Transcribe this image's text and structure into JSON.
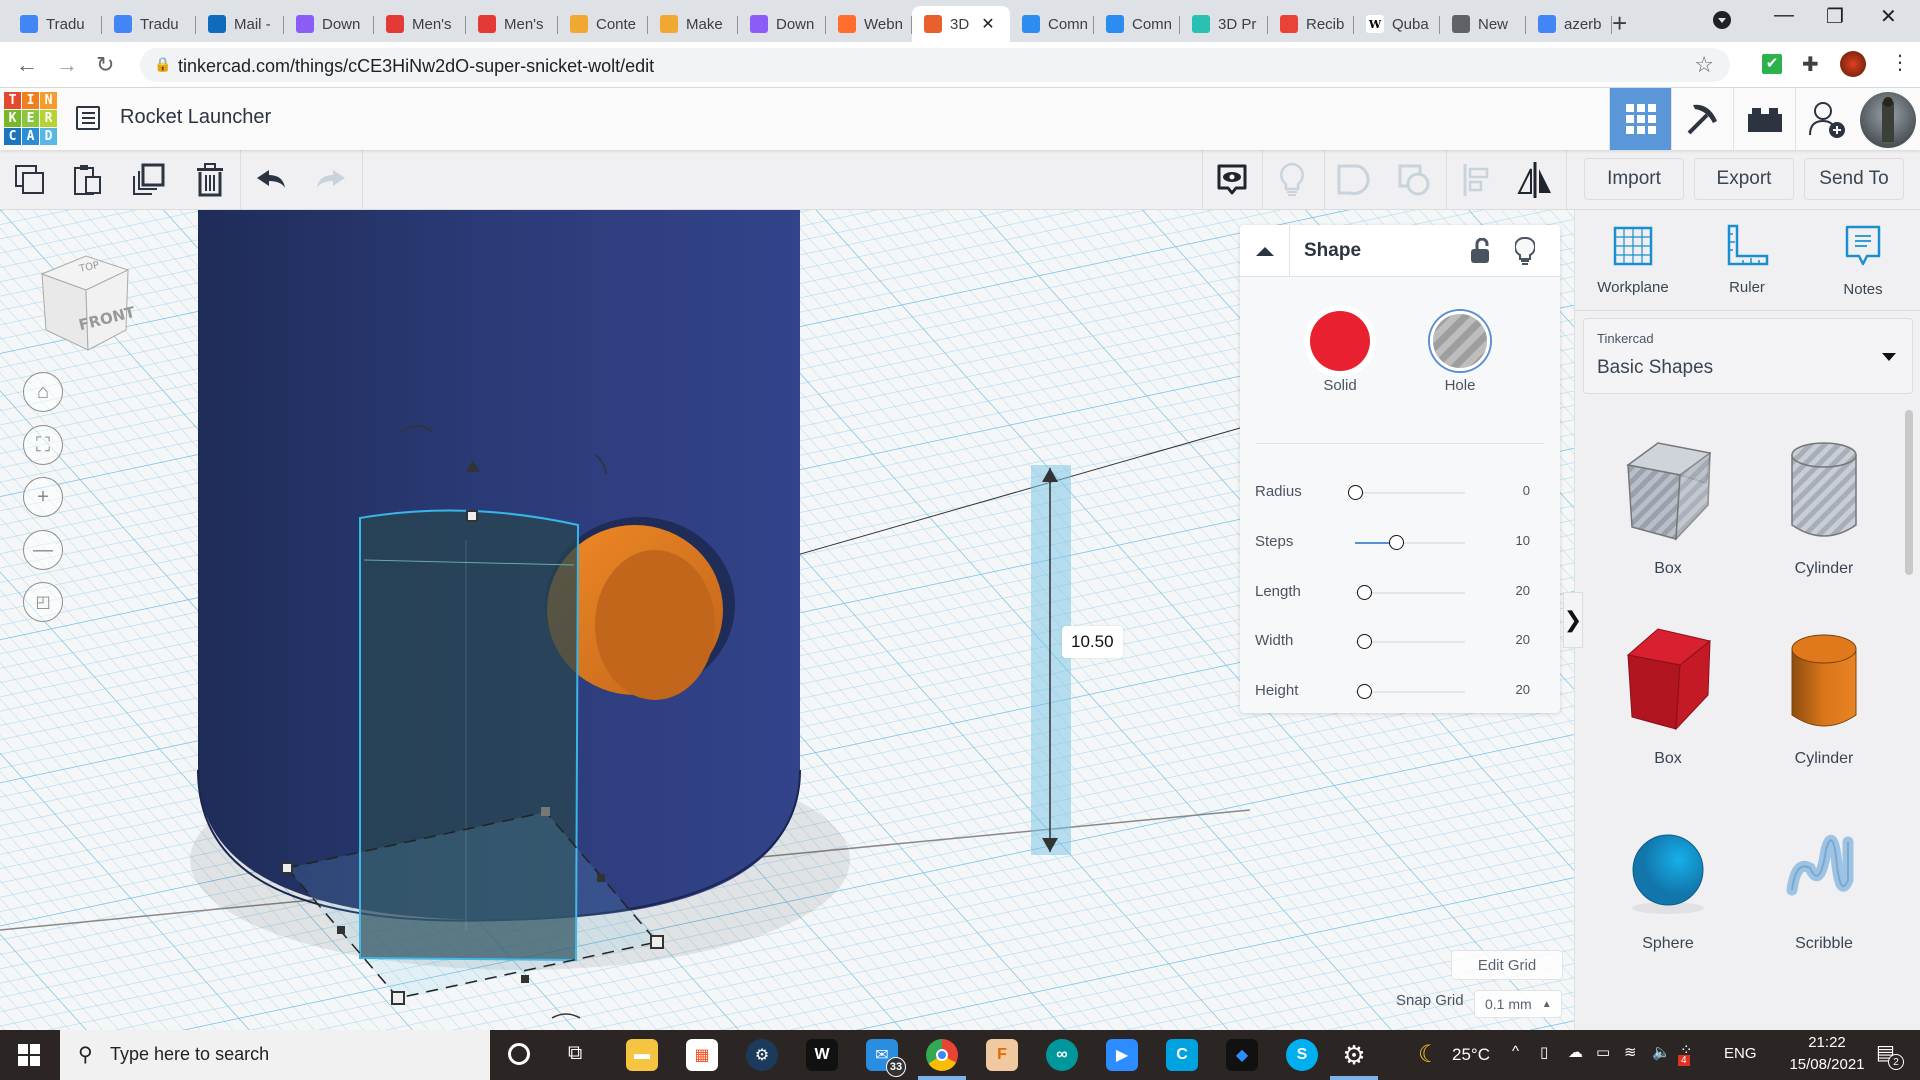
{
  "browser": {
    "tabs": [
      {
        "label": "Tradu",
        "icon": "google-translate-icon",
        "color": "#4285f4"
      },
      {
        "label": "Tradu",
        "icon": "google-translate-icon",
        "color": "#4285f4"
      },
      {
        "label": "Mail -",
        "icon": "outlook-icon",
        "color": "#0f6cbd"
      },
      {
        "label": "Down",
        "icon": "swirl-icon",
        "color": "#8b5cf6"
      },
      {
        "label": "Men's",
        "icon": "shopping-bag-icon",
        "color": "#e53935"
      },
      {
        "label": "Men's",
        "icon": "shopping-bag-icon",
        "color": "#e53935"
      },
      {
        "label": "Conte",
        "icon": "robot-icon",
        "color": "#f0a830"
      },
      {
        "label": "Make",
        "icon": "robot-icon",
        "color": "#f0a830"
      },
      {
        "label": "Down",
        "icon": "swirl-icon",
        "color": "#8b5cf6"
      },
      {
        "label": "Webn",
        "icon": "cpanel-icon",
        "color": "#ff6c2c"
      },
      {
        "label": "3D",
        "icon": "tinkercad-icon",
        "color": "#e8602c",
        "active": true
      },
      {
        "label": "Comn",
        "icon": "t-circle-icon",
        "color": "#2d8cf0"
      },
      {
        "label": "Comn",
        "icon": "t-circle-icon",
        "color": "#2d8cf0"
      },
      {
        "label": "3D Pr",
        "icon": "h-square-icon",
        "color": "#28c0b0"
      },
      {
        "label": "Recib",
        "icon": "gmail-icon",
        "color": "#ea4335"
      },
      {
        "label": "Quba",
        "icon": "wikipedia-icon",
        "color": "#ffffff"
      },
      {
        "label": "New",
        "icon": "chrome-icon",
        "color": "#5f6368"
      },
      {
        "label": "azerb",
        "icon": "google-icon",
        "color": "#4285f4"
      }
    ],
    "url": "tinkercad.com/things/cCE3HiNw2dO-super-snicket-wolt/edit"
  },
  "app": {
    "logo_letters": [
      "T",
      "I",
      "N",
      "K",
      "E",
      "R",
      "C",
      "A",
      "D"
    ],
    "logo_colors": [
      "#e2492f",
      "#f07d1e",
      "#f59c2a",
      "#76b82a",
      "#8cc63f",
      "#b5d334",
      "#1b75bc",
      "#2b8ed4",
      "#58b7e5"
    ],
    "project_title": "Rocket Launcher"
  },
  "toolbar": {
    "import_label": "Import",
    "export_label": "Export",
    "send_to_label": "Send To"
  },
  "viewport": {
    "viewcube_top": "TOP",
    "viewcube_front": "FRONT",
    "dimension_value": "10.50"
  },
  "inspector": {
    "title": "Shape",
    "solid_label": "Solid",
    "hole_label": "Hole",
    "solid_color": "#e8202f",
    "selected_mode": "Hole",
    "params": [
      {
        "label": "Radius",
        "value": "0",
        "fraction": 0.0
      },
      {
        "label": "Steps",
        "value": "10",
        "fraction": 0.37
      },
      {
        "label": "Length",
        "value": "20",
        "fraction": 0.08
      },
      {
        "label": "Width",
        "value": "20",
        "fraction": 0.08
      },
      {
        "label": "Height",
        "value": "20",
        "fraction": 0.08
      }
    ]
  },
  "right_panel": {
    "tools": [
      {
        "label": "Workplane",
        "icon": "workplane-icon"
      },
      {
        "label": "Ruler",
        "icon": "ruler-icon"
      },
      {
        "label": "Notes",
        "icon": "notes-icon"
      }
    ],
    "library_category": "Tinkercad",
    "library_name": "Basic Shapes",
    "shapes": [
      {
        "label": "Box",
        "kind": "hole-box"
      },
      {
        "label": "Cylinder",
        "kind": "hole-cylinder"
      },
      {
        "label": "Box",
        "kind": "box",
        "color": "#c91826"
      },
      {
        "label": "Cylinder",
        "kind": "cylinder",
        "color": "#e07a1c"
      },
      {
        "label": "Sphere",
        "kind": "sphere",
        "color": "#1a9bd7"
      },
      {
        "label": "Scribble",
        "kind": "scribble",
        "color": "#8fb8dc"
      }
    ],
    "edit_grid_label": "Edit Grid",
    "snap_grid_label": "Snap Grid",
    "snap_grid_value": "0.1 mm"
  },
  "taskbar": {
    "search_placeholder": "Type here to search",
    "mail_badge": "33",
    "weather": "25°C",
    "language": "ENG",
    "time": "21:22",
    "date": "15/08/2021",
    "notifications": "2",
    "tray_badge": "4"
  }
}
